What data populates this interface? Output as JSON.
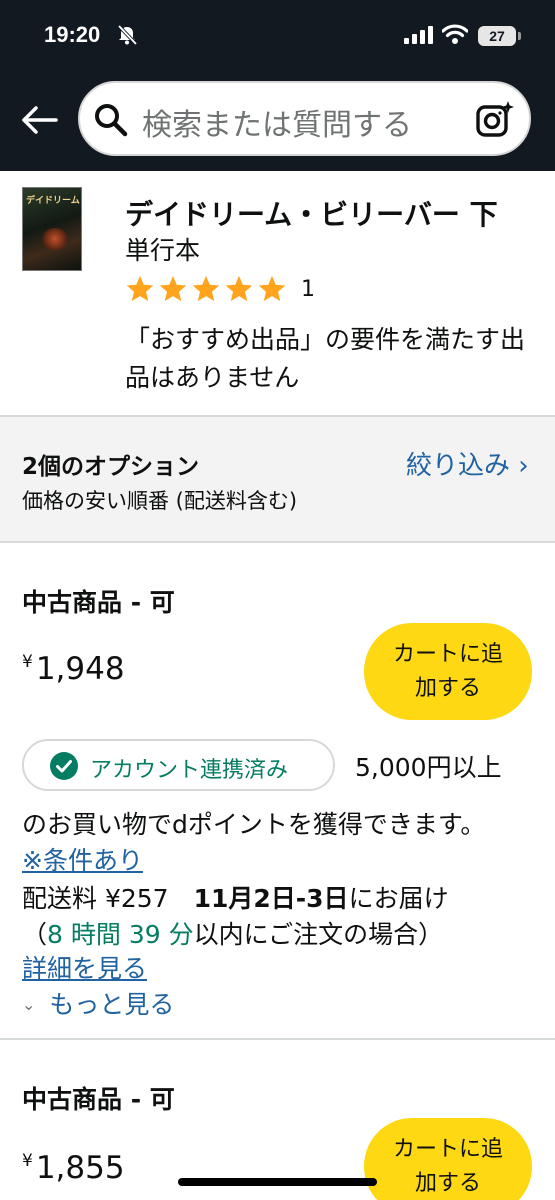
{
  "status_bar": {
    "time": "19:20",
    "battery": "27"
  },
  "search": {
    "placeholder": "検索または質問する"
  },
  "product": {
    "cover_text": "デイドリーム・ビリーバー",
    "title": "デイドリーム・ビリーバー 下",
    "format": "単行本",
    "rating_stars": 5,
    "rating_count": "1",
    "note": "「おすすめ出品」の要件を満たす出品はありません"
  },
  "options": {
    "count_label": "2個のオプション",
    "sort_label": "価格の安い順番 (配送料含む)",
    "filter_label": "絞り込み ›"
  },
  "offers": [
    {
      "condition": "中古商品 - 可",
      "currency": "¥",
      "price": "1,948",
      "cart_label": "カートに追加する",
      "badge_label": "アカウント連携済み",
      "point_head": "5,000円以上",
      "point_text": "のお買い物でdポイントを獲得できます。",
      "conditions_link": "※条件あり",
      "shipping_label": "配送料 ¥257",
      "delivery_date": "11月2日-3日",
      "delivery_suffix": "にお届け",
      "deadline_open": "（",
      "deadline_time": "8 時間 39 分",
      "deadline_rest": "以内にご注文の場合）",
      "details_link": "詳細を見る",
      "more_label": "もっと見る"
    },
    {
      "condition": "中古商品 - 可",
      "currency": "¥",
      "price": "1,855",
      "cart_label": "カートに追加する"
    }
  ],
  "colors": {
    "header_bg": "#131921",
    "cart_button": "#ffd814",
    "link": "#2162a1",
    "success_green": "#067d62",
    "star": "#ffa41c",
    "options_bg": "#f3f3f3"
  },
  "icons": [
    "bell-slash-icon",
    "signal-icon",
    "wifi-icon",
    "battery-icon",
    "back-arrow-icon",
    "search-icon",
    "camera-search-icon",
    "star-icon",
    "check-circle-icon",
    "chevron-down-icon"
  ]
}
